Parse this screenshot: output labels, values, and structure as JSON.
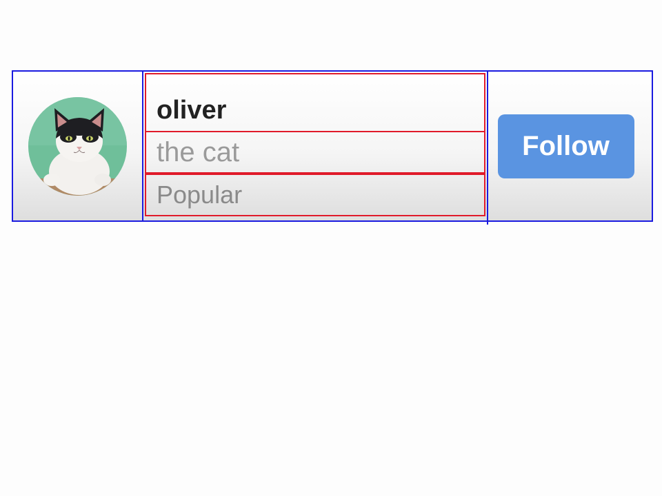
{
  "profile": {
    "name": "oliver",
    "subtitle": "the cat",
    "tag": "Popular",
    "avatar_icon": "cat-avatar"
  },
  "actions": {
    "follow_label": "Follow"
  },
  "colors": {
    "follow_button_bg": "#5a94e1",
    "outer_outline": "#1a1ae0",
    "row_outline": "#e01a2a",
    "avatar_bg": "#6fbf9a"
  }
}
